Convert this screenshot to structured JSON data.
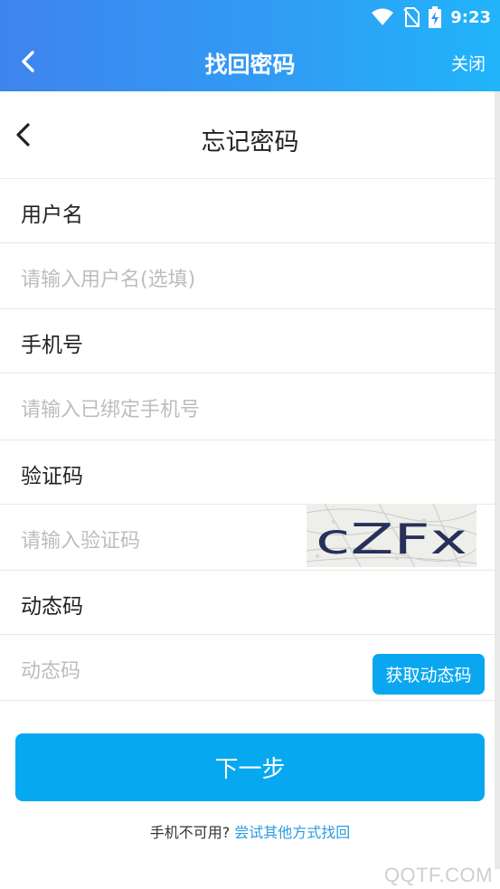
{
  "status_bar": {
    "time": "9:23"
  },
  "header": {
    "title": "找回密码",
    "close_label": "关闭"
  },
  "page": {
    "title": "忘记密码"
  },
  "fields": [
    {
      "label": "用户名",
      "placeholder": "请输入用户名(选填)"
    },
    {
      "label": "手机号",
      "placeholder": "请输入已绑定手机号"
    },
    {
      "label": "验证码",
      "placeholder": "请输入验证码"
    },
    {
      "label": "动态码",
      "placeholder": "动态码"
    }
  ],
  "captcha": {
    "text": "cZFx"
  },
  "dynamic_code_button": {
    "label": "获取动态码"
  },
  "next_button": {
    "label": "下一步"
  },
  "footer": {
    "prompt": "手机不可用?",
    "link": "尝试其他方式找回"
  },
  "watermark": "QQTF.COM",
  "colors": {
    "accent": "#06a8f0",
    "header_start": "#3f84ee",
    "header_end": "#21b4fa",
    "link": "#2d9be0"
  }
}
